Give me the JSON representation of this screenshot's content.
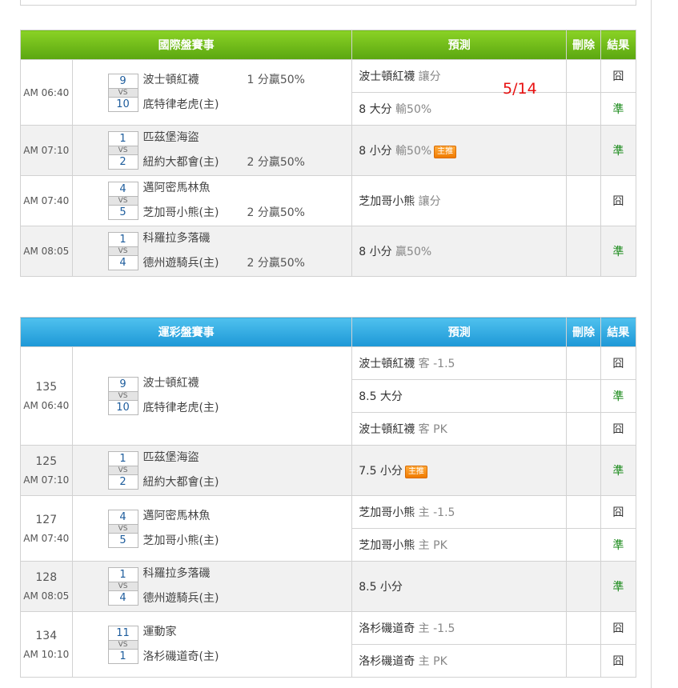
{
  "headers": {
    "international": "國際盤賽事",
    "lottery": "運彩盤賽事",
    "prediction": "預測",
    "delete": "刪除",
    "result": "結果"
  },
  "annotation": "5/14",
  "international": [
    {
      "time": "AM 06:40",
      "away": "波士頓紅襪",
      "home": "底特律老虎(主)",
      "away_score": "9",
      "home_score": "10",
      "note_away": "1 分贏50%",
      "note_home": "",
      "preds": [
        {
          "main": "波士頓紅襪",
          "sub": "讓分",
          "badge": "",
          "result": "囧",
          "ok": false
        },
        {
          "main": "8 大分",
          "sub": "輸50%",
          "badge": "",
          "result": "準",
          "ok": true
        }
      ]
    },
    {
      "time": "AM 07:10",
      "away": "匹茲堡海盜",
      "home": "紐約大都會(主)",
      "away_score": "1",
      "home_score": "2",
      "note_away": "",
      "note_home": "2 分贏50%",
      "preds": [
        {
          "main": "8 小分",
          "sub": "輸50%",
          "badge": "主推",
          "result": "準",
          "ok": true
        }
      ]
    },
    {
      "time": "AM 07:40",
      "away": "邁阿密馬林魚",
      "home": "芝加哥小熊(主)",
      "away_score": "4",
      "home_score": "5",
      "note_away": "",
      "note_home": "2 分贏50%",
      "preds": [
        {
          "main": "芝加哥小熊",
          "sub": "讓分",
          "badge": "",
          "result": "囧",
          "ok": false
        }
      ]
    },
    {
      "time": "AM 08:05",
      "away": "科羅拉多落磯",
      "home": "德州遊騎兵(主)",
      "away_score": "1",
      "home_score": "4",
      "note_away": "",
      "note_home": "2 分贏50%",
      "preds": [
        {
          "main": "8 小分",
          "sub": "贏50%",
          "badge": "",
          "result": "準",
          "ok": true
        }
      ]
    }
  ],
  "lottery": [
    {
      "code": "135",
      "time": "AM 06:40",
      "away": "波士頓紅襪",
      "home": "底特律老虎(主)",
      "away_score": "9",
      "home_score": "10",
      "preds": [
        {
          "main": "波士頓紅襪",
          "sub": "客 -1.5",
          "badge": "",
          "result": "囧",
          "ok": false
        },
        {
          "main": "8.5 大分",
          "sub": "",
          "badge": "",
          "result": "準",
          "ok": true
        },
        {
          "main": "波士頓紅襪",
          "sub": "客 PK",
          "badge": "",
          "result": "囧",
          "ok": false
        }
      ]
    },
    {
      "code": "125",
      "time": "AM 07:10",
      "away": "匹茲堡海盜",
      "home": "紐約大都會(主)",
      "away_score": "1",
      "home_score": "2",
      "preds": [
        {
          "main": "7.5 小分",
          "sub": "",
          "badge": "主推",
          "result": "準",
          "ok": true
        }
      ]
    },
    {
      "code": "127",
      "time": "AM 07:40",
      "away": "邁阿密馬林魚",
      "home": "芝加哥小熊(主)",
      "away_score": "4",
      "home_score": "5",
      "preds": [
        {
          "main": "芝加哥小熊",
          "sub": "主 -1.5",
          "badge": "",
          "result": "囧",
          "ok": false
        },
        {
          "main": "芝加哥小熊",
          "sub": "主 PK",
          "badge": "",
          "result": "準",
          "ok": true
        }
      ]
    },
    {
      "code": "128",
      "time": "AM 08:05",
      "away": "科羅拉多落磯",
      "home": "德州遊騎兵(主)",
      "away_score": "1",
      "home_score": "4",
      "preds": [
        {
          "main": "8.5 小分",
          "sub": "",
          "badge": "",
          "result": "準",
          "ok": true
        }
      ]
    },
    {
      "code": "134",
      "time": "AM 10:10",
      "away": "運動家",
      "home": "洛杉磯道奇(主)",
      "away_score": "11",
      "home_score": "1",
      "preds": [
        {
          "main": "洛杉磯道奇",
          "sub": "主 -1.5",
          "badge": "",
          "result": "囧",
          "ok": false
        },
        {
          "main": "洛杉磯道奇",
          "sub": "主 PK",
          "badge": "",
          "result": "囧",
          "ok": false
        }
      ]
    }
  ]
}
